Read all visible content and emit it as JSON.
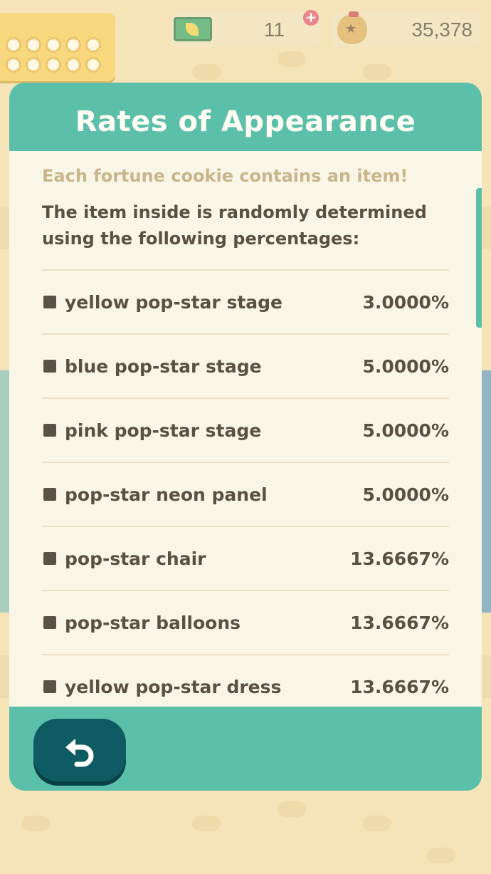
{
  "hud": {
    "leaf_tickets": "11",
    "bells": "35,378"
  },
  "modal": {
    "title": "Rates of Appearance",
    "intro": "Each fortune cookie contains an item!",
    "description": "The item inside is randomly determined using the following percentages:",
    "rates": [
      {
        "name": "yellow pop-star stage",
        "value": "3.0000%"
      },
      {
        "name": "blue pop-star stage",
        "value": "5.0000%"
      },
      {
        "name": "pink pop-star stage",
        "value": "5.0000%"
      },
      {
        "name": "pop-star neon panel",
        "value": "5.0000%"
      },
      {
        "name": "pop-star chair",
        "value": "13.6667%"
      },
      {
        "name": "pop-star balloons",
        "value": "13.6667%"
      },
      {
        "name": "yellow pop-star dress",
        "value": "13.6667%"
      }
    ]
  },
  "icons": {
    "back": "back-arrow-icon",
    "leaf_ticket": "leaf-ticket-icon",
    "bell_bag": "bell-bag-icon",
    "add": "plus-icon"
  },
  "colors": {
    "teal": "#5cbfa9",
    "dark_teal": "#0f5b63",
    "panel": "#f9f6e7",
    "text": "#5b5143",
    "muted": "#c8b58a"
  }
}
